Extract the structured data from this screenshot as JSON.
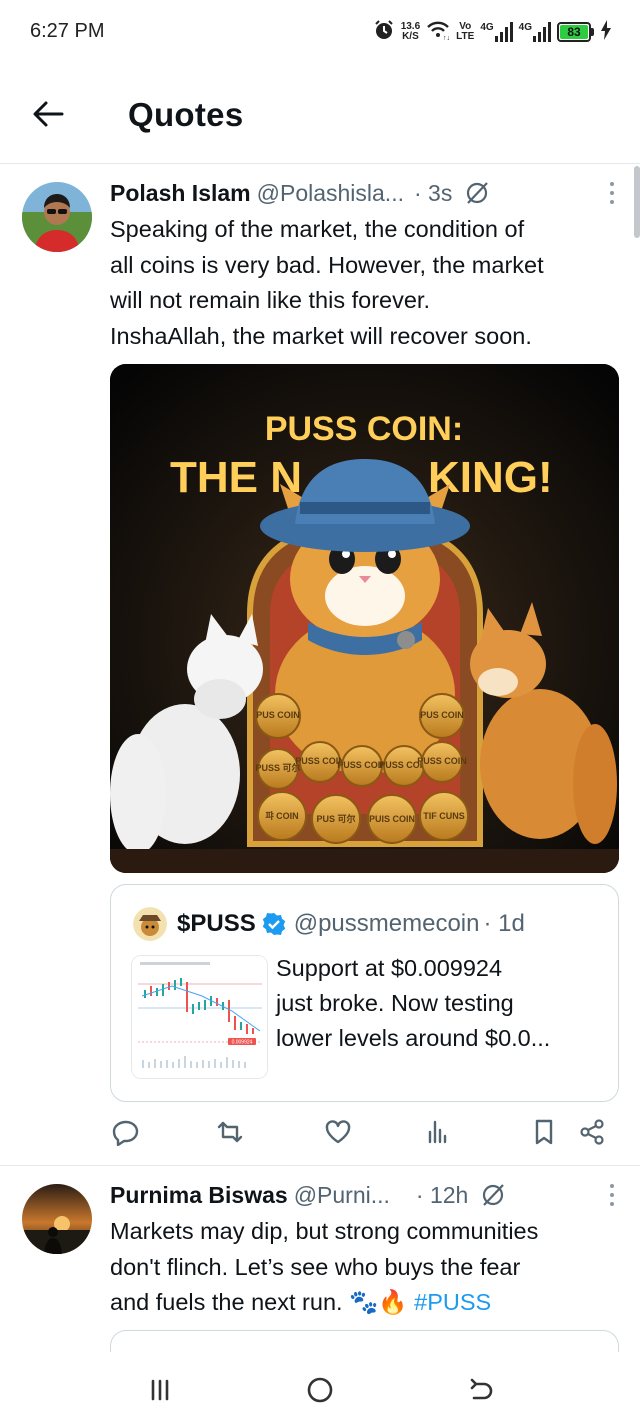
{
  "status_bar": {
    "time": "6:27 PM",
    "net_speed_value": "13.6",
    "net_speed_unit": "K/S",
    "volte_top": "Vo",
    "volte_bottom": "LTE",
    "signal_1_label": "4G",
    "signal_2_label": "4G",
    "battery_level": "83",
    "icons": [
      "alarm-icon",
      "wifi-icon",
      "signal-icon",
      "signal-icon",
      "battery-icon",
      "charging-icon"
    ]
  },
  "header": {
    "title": "Quotes",
    "back_icon": "arrow-left-icon"
  },
  "posts": [
    {
      "author_name": "Polash Islam",
      "author_handle": "@Polashisla...",
      "time": "· 3s",
      "text_lines": [
        "Speaking of the market, the condition of",
        "all coins is very bad. However, the market",
        "will not remain like this forever.",
        "InshaAllah, the market will recover soon."
      ],
      "image": {
        "headline_1": "PUSS COIN:",
        "headline_2": "THE N",
        "headline_3": "KING!",
        "coin_labels": [
          "PUS COIN",
          "PUS COIN",
          "PUSS 可尔",
          "PUSS COIN",
          "PUSS COIN",
          "PUSS COIN",
          "PUSS COIN",
          "퍄 COIN",
          "PUS 可尔",
          "PUIS COIN",
          "TIF CUNS"
        ]
      },
      "quoted": {
        "name": "$PUSS",
        "handle": "@pussmemecoin",
        "time": "· 1d",
        "text_lines": [
          "Support at $0.009924",
          "just broke. Now testing",
          "lower levels around $0.0..."
        ],
        "thumb_price_label": "0.009924"
      },
      "actions": [
        "reply-icon",
        "repost-icon",
        "like-icon",
        "views-icon",
        "bookmark-icon",
        "share-icon"
      ]
    },
    {
      "author_name": "Purnima Biswas",
      "author_handle": "@Purni...",
      "time": "· 12h",
      "text_lines": [
        "Markets may dip, but strong communities",
        "don't flinch. Let’s see who buys the fear",
        "and fuels the next run. 🐾🔥 "
      ],
      "hashtag": "#PUSS"
    }
  ],
  "nav_bar": {
    "icons": [
      "recent-apps-icon",
      "home-icon",
      "back-icon"
    ]
  },
  "colors": {
    "text": "#0f1419",
    "secondary_text": "#536471",
    "link": "#1d9bf0",
    "divider": "#e6e9ec",
    "battery": "#2ecc40",
    "verified": "#1d9bf0",
    "coin_gold": "#d9a13a"
  }
}
